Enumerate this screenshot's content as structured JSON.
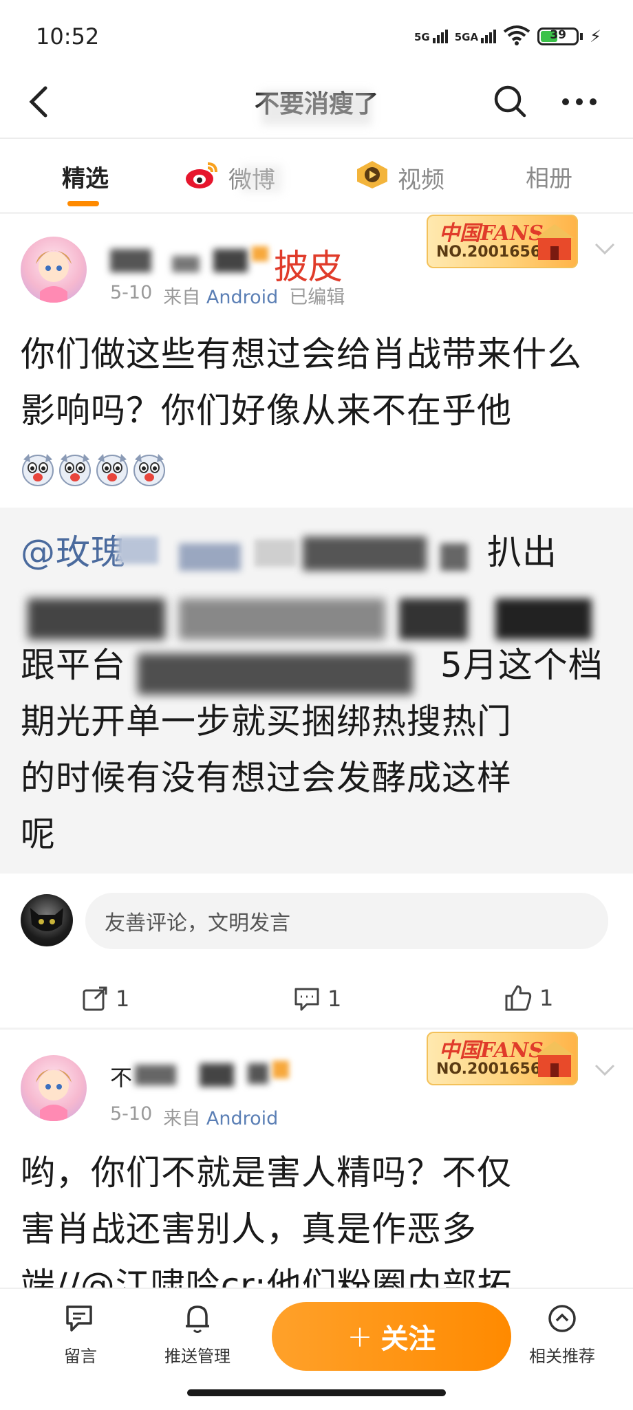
{
  "status_bar": {
    "time": "10:52",
    "signal1": "5G",
    "signal2": "5GA",
    "battery": "39"
  },
  "nav": {
    "title": "不要消瘦了"
  },
  "tabs": [
    {
      "label": "精选",
      "active": true
    },
    {
      "label": "微博",
      "active": false
    },
    {
      "label": "视频",
      "active": false
    },
    {
      "label": "相册",
      "active": false
    }
  ],
  "post1": {
    "username_tag": "披皮",
    "meta": {
      "date": "5-10",
      "from": "来自",
      "source": "Android",
      "edited": "已编辑"
    },
    "badge": {
      "line1": "中国FANS",
      "line2": "NO.2001656"
    },
    "text": "你们做这些有想过会给肖战带来什么影响吗？你们好像从来不在乎他",
    "emojis": [
      "dog-emoji",
      "dog-emoji",
      "dog-emoji",
      "dog-emoji"
    ],
    "repost": {
      "line1_prefix": "@玫瑰",
      "line1_suffix": "扒出",
      "line3": "跟平台",
      "line3_suffix": "5月这个档",
      "line4": "期光开单一步就买捆绑热搜热门",
      "line5": "的时候有没有想过会发酵成这样",
      "line6": "呢"
    },
    "comment_placeholder": "友善评论，文明发言",
    "actions": {
      "reposts": "1",
      "comments": "1",
      "likes": "1"
    }
  },
  "post2": {
    "username_prefix": "不",
    "meta": {
      "date": "5-10",
      "from": "来自",
      "source": "Android"
    },
    "badge": {
      "line1": "中国FANS",
      "line2": "NO.2001656"
    },
    "line1": "哟，你们不就是害人精吗？不仅",
    "line2": "害肖战还害别人，真是作恶多",
    "line3": "端//@江啸吟cr:他们粉圈内部拓"
  },
  "bottom_bar": {
    "message": "留言",
    "push_manage": "推送管理",
    "follow": "关注",
    "follow_plus": "+",
    "related": "相关推荐"
  },
  "colors": {
    "accent_orange": "#ff8a00",
    "link_blue": "#4a6a9d",
    "tag_red": "#e03b2a"
  }
}
